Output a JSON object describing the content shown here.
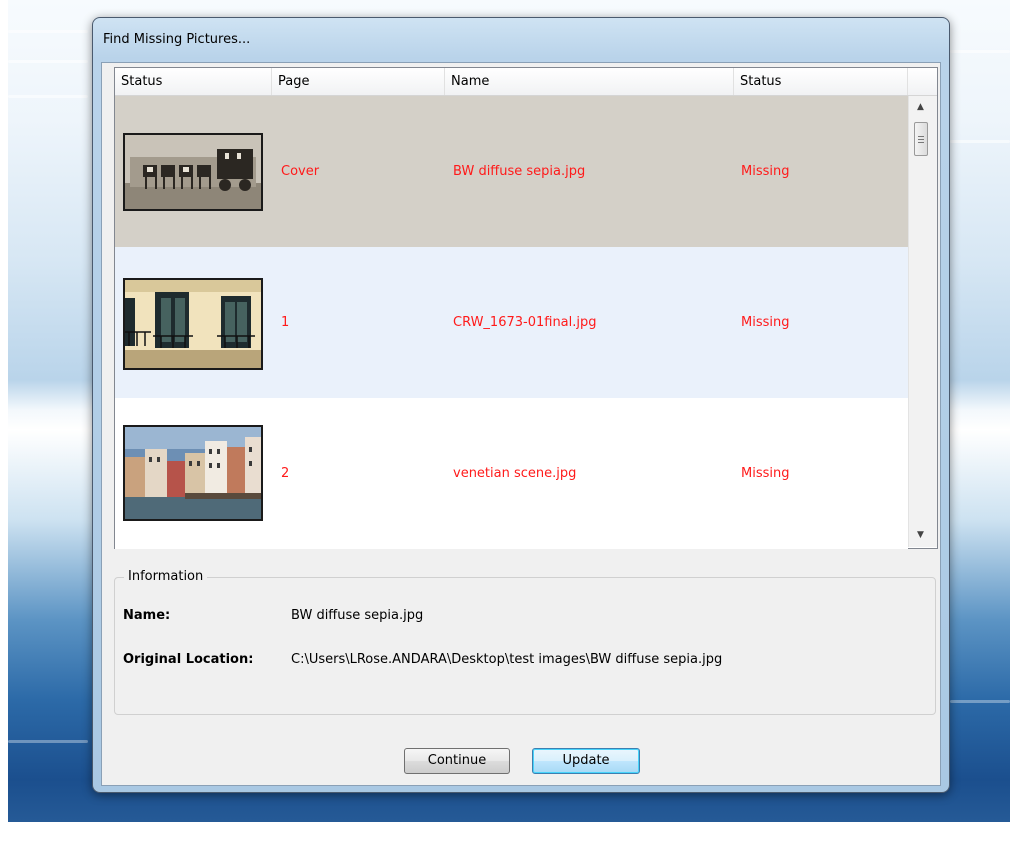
{
  "dialog": {
    "title": "Find Missing Pictures..."
  },
  "list": {
    "columns": [
      "Status",
      "Page",
      "Name",
      "Status"
    ],
    "rows": [
      {
        "page": "Cover",
        "name": "BW diffuse sepia.jpg",
        "status": "Missing",
        "thumbnail": "sepia-horse-carriage-photo",
        "selected": true
      },
      {
        "page": "1",
        "name": "CRW_1673-01final.jpg",
        "status": "Missing",
        "thumbnail": "building-balconies-photo",
        "selected": false
      },
      {
        "page": "2",
        "name": "venetian scene.jpg",
        "status": "Missing",
        "thumbnail": "venice-canal-photo",
        "selected": false
      }
    ]
  },
  "information": {
    "legend": "Information",
    "name_label": "Name:",
    "name_value": "BW diffuse sepia.jpg",
    "location_label": "Original Location:",
    "location_value": "C:\\Users\\LRose.ANDARA\\Desktop\\test images\\BW diffuse sepia.jpg"
  },
  "buttons": {
    "continue": "Continue",
    "update": "Update"
  },
  "colors": {
    "missing_text": "#ff1a1a",
    "selected_row": "#d4d0c8",
    "alt_row": "#eaf1fb"
  },
  "icons": {
    "scroll_up": "scroll-up-arrow-icon",
    "scroll_down": "scroll-down-arrow-icon"
  }
}
